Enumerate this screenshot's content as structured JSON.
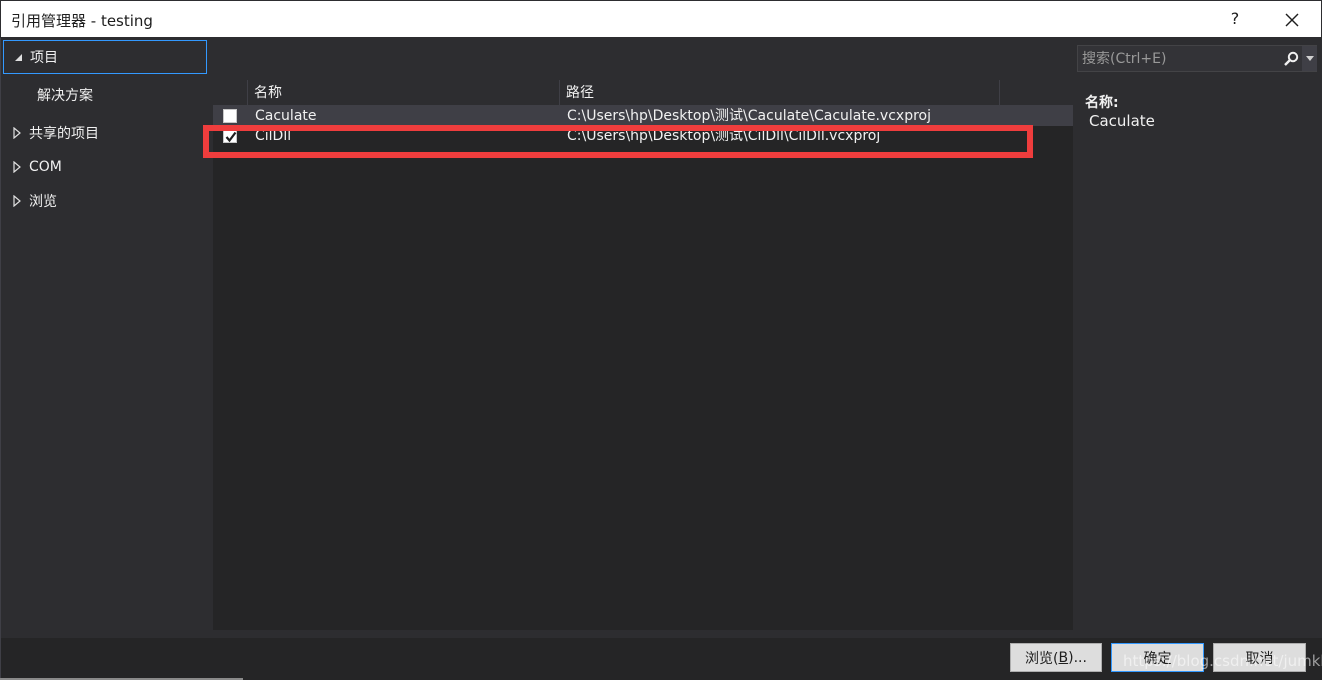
{
  "window": {
    "title": "引用管理器 - testing",
    "help_label": "?",
    "close_icon": "close-icon"
  },
  "sidebar": {
    "items": [
      {
        "label": "项目",
        "expanded": true,
        "selected": true,
        "icon": "triangle-expanded-icon"
      },
      {
        "label": "解决方案",
        "child": true
      },
      {
        "label": "共享的项目",
        "expanded": false,
        "icon": "triangle-collapsed-icon"
      },
      {
        "label": "COM",
        "expanded": false,
        "icon": "triangle-collapsed-icon"
      },
      {
        "label": "浏览",
        "expanded": false,
        "icon": "triangle-collapsed-icon"
      }
    ]
  },
  "grid": {
    "columns": [
      "名称",
      "路径"
    ],
    "rows": [
      {
        "checked": false,
        "name": "Caculate",
        "path": "C:\\Users\\hp\\Desktop\\测试\\Caculate\\Caculate.vcxproj"
      },
      {
        "checked": true,
        "name": "CilDll",
        "path": "C:\\Users\\hp\\Desktop\\测试\\CilDll\\CilDll.vcxproj"
      }
    ]
  },
  "search": {
    "placeholder": "搜索(Ctrl+E)",
    "value": ""
  },
  "details": {
    "name_label": "名称:",
    "name_value": "Caculate"
  },
  "footer": {
    "browse_label": "浏览(",
    "browse_mnemonic": "B",
    "browse_suffix": ")...",
    "ok_label": "确定",
    "cancel_label": "取消",
    "watermark": "https://blog.csdn.net/jumkk"
  },
  "colors": {
    "accent": "#3399ff",
    "highlight_box": "#ef3d3d",
    "background": "#2d2d30",
    "grid_background": "#252526"
  }
}
